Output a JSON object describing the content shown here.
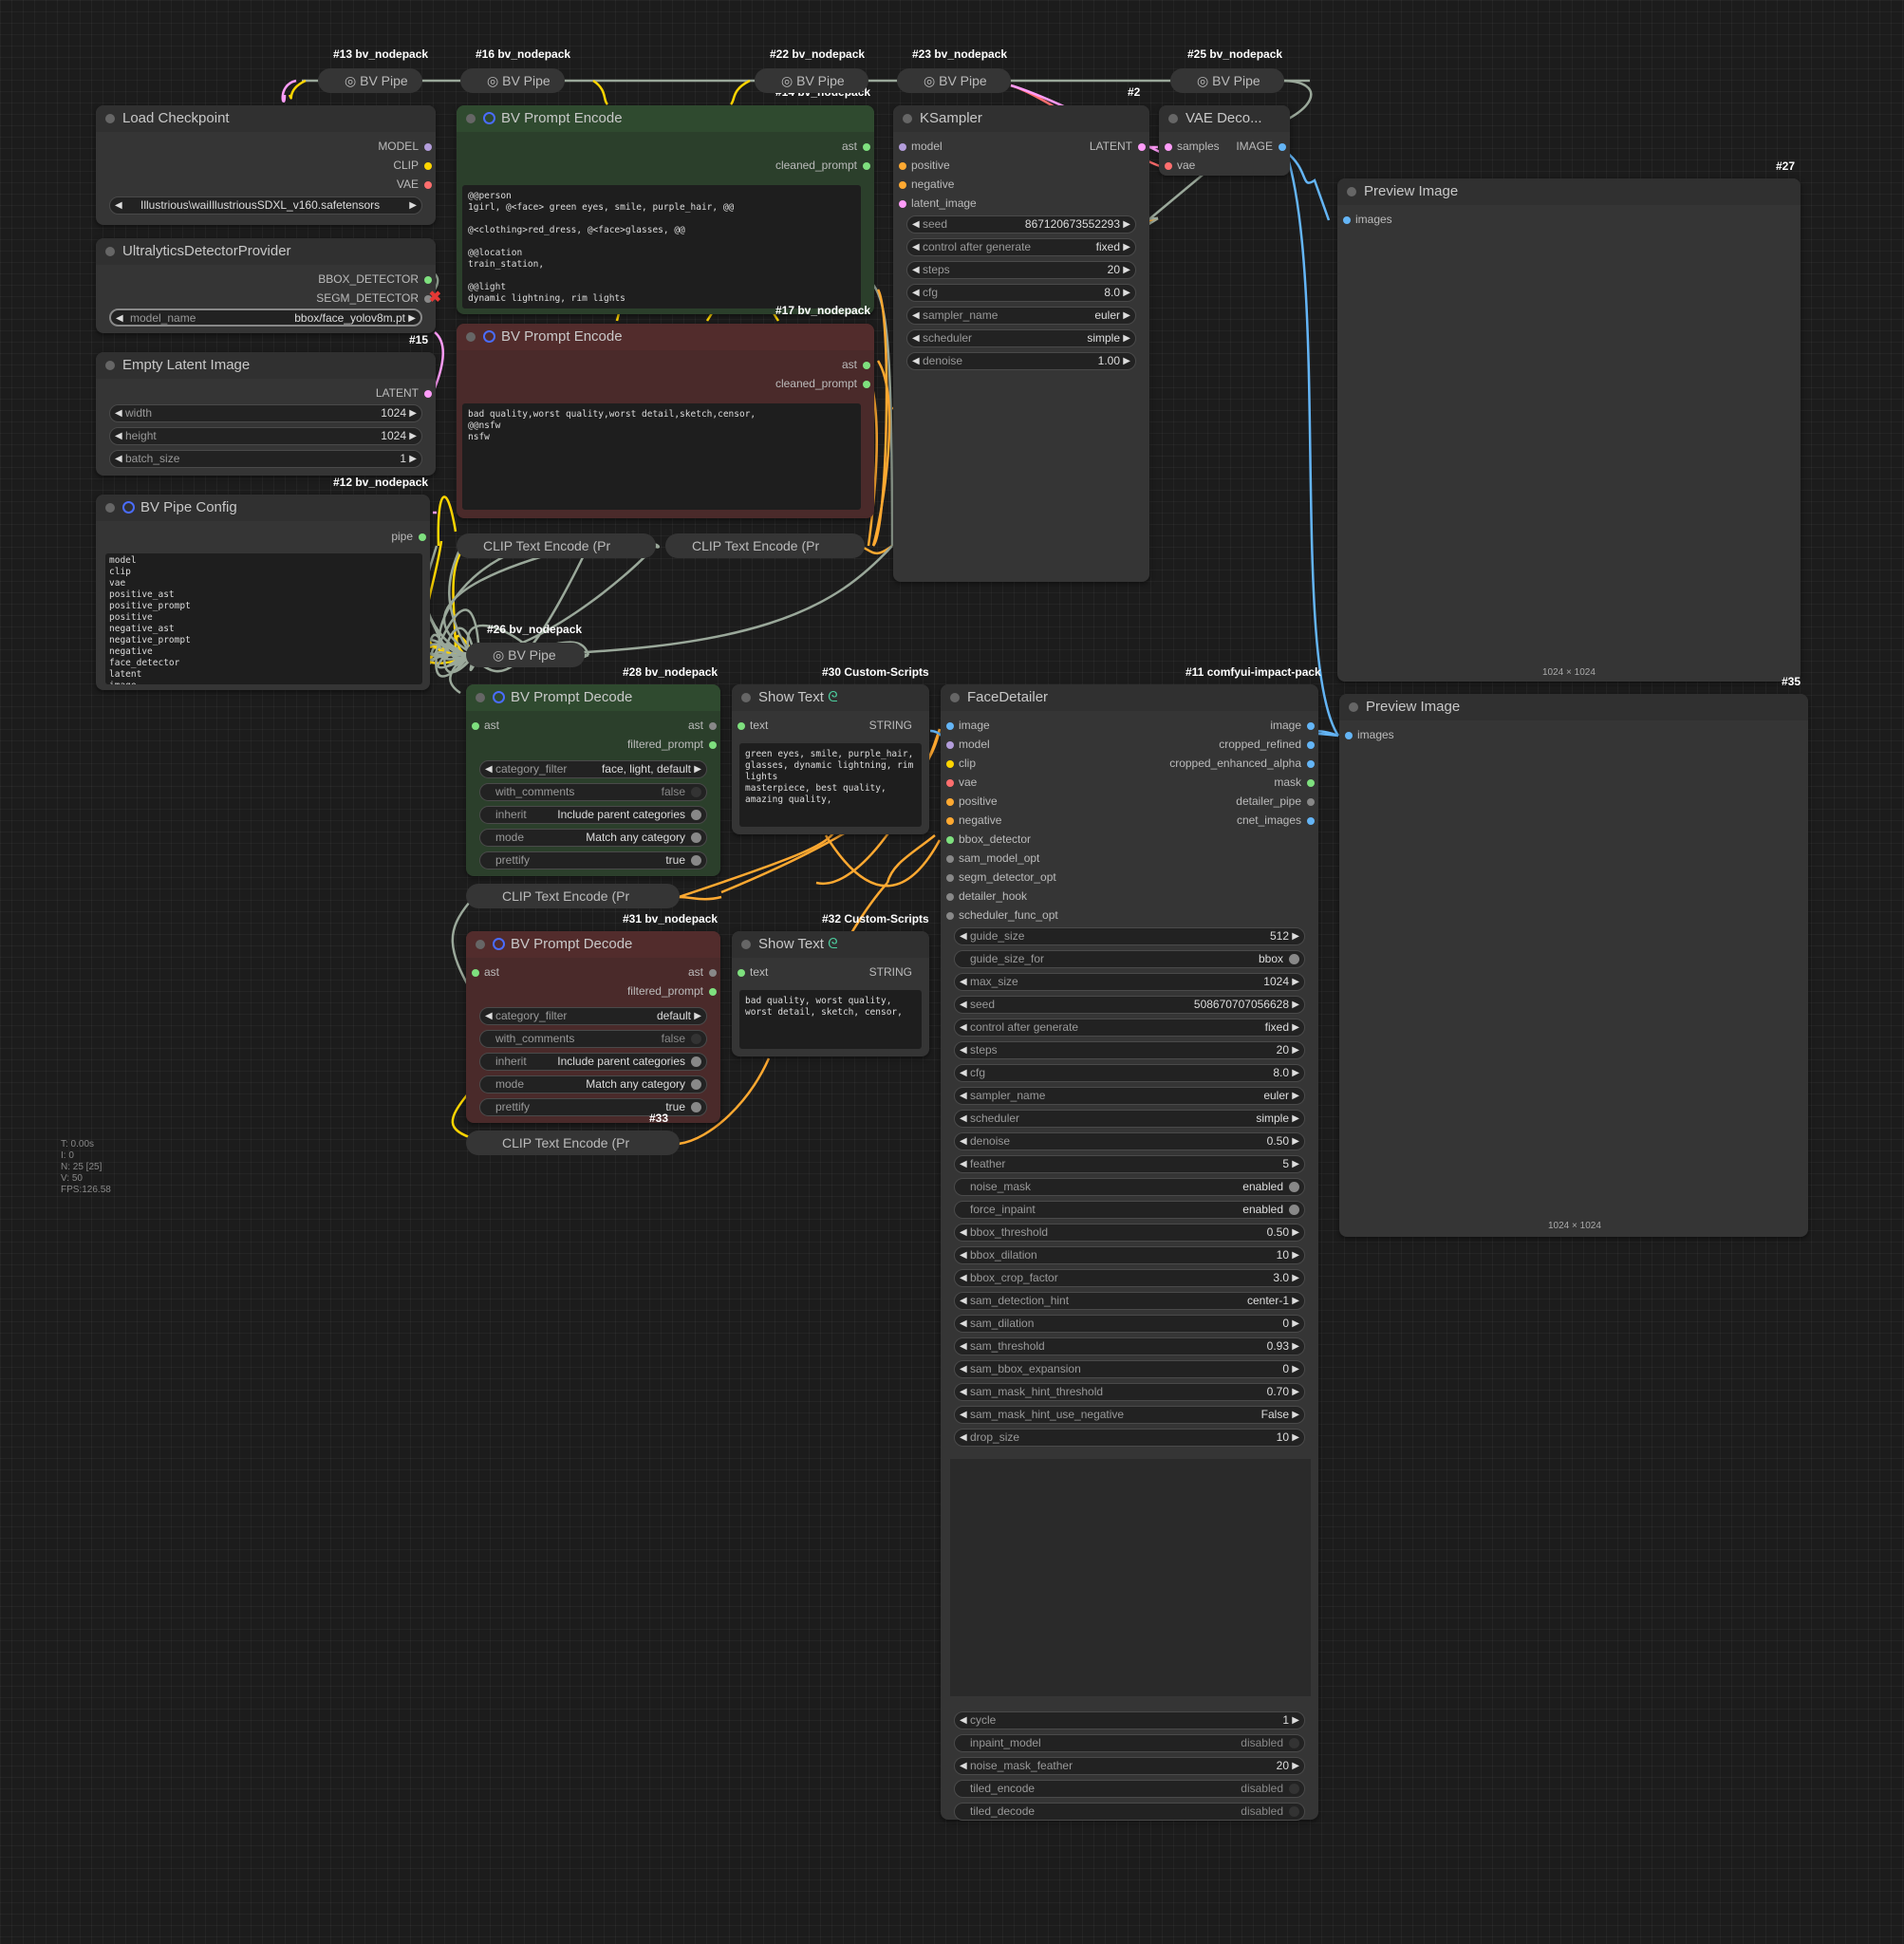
{
  "tags": {
    "t13": "#13 bv_nodepack",
    "t16": "#16 bv_nodepack",
    "t22": "#22 bv_nodepack",
    "t23": "#23 bv_nodepack",
    "t25": "#25 bv_nodepack",
    "t14": "#14 bv_nodepack",
    "t2": "#2",
    "t27": "#27",
    "t15": "#15",
    "t17": "#17 bv_nodepack",
    "t12": "#12 bv_nodepack",
    "t26": "#26 bv_nodepack",
    "t28": "#28 bv_nodepack",
    "t30": "#30 Custom-Scripts",
    "t11": "#11 comfyui-impact-pack",
    "t35": "#35",
    "t31": "#31 bv_nodepack",
    "t32": "#32 Custom-Scripts",
    "t33": "#33"
  },
  "pipes": {
    "label": "BV Pipe"
  },
  "load_checkpoint": {
    "title": "Load Checkpoint",
    "outputs": [
      "MODEL",
      "CLIP",
      "VAE"
    ],
    "ckpt_name": "Illustrious\\waiIllustriousSDXL_v160.safetensors"
  },
  "detector": {
    "title": "UltralyticsDetectorProvider",
    "outputs": [
      "BBOX_DETECTOR",
      "SEGM_DETECTOR"
    ],
    "model_label": "model_name",
    "model_value": "bbox/face_yolov8m.pt"
  },
  "latent": {
    "title": "Empty Latent Image",
    "output": "LATENT",
    "width_label": "width",
    "width": "1024",
    "height_label": "height",
    "height": "1024",
    "batch_label": "batch_size",
    "batch": "1"
  },
  "pipe_config": {
    "title": "BV Pipe Config",
    "output": "pipe",
    "list": "model\nclip\nvae\npositive_ast\npositive_prompt\npositive\nnegative_ast\nnegative_prompt\nnegative\nface_detector\nlatent\nimage"
  },
  "prompt_pos": {
    "title": "BV Prompt Encode",
    "out1": "ast",
    "out2": "cleaned_prompt",
    "text": "@@person\n1girl, @<face> green eyes, smile, purple_hair, @@\n\n@<clothing>red_dress, @<face>glasses, @@\n\n@@location\ntrain_station,\n\n@@light\ndynamic lightning, rim lights\n\n@@"
  },
  "prompt_neg": {
    "title": "BV Prompt Encode",
    "out1": "ast",
    "out2": "cleaned_prompt",
    "text": "bad quality,worst quality,worst detail,sketch,censor,\n@@nsfw\nnsfw"
  },
  "clip_text": "CLIP Text Encode (Pr",
  "ksampler": {
    "title": "KSampler",
    "inputs": [
      "model",
      "positive",
      "negative",
      "latent_image"
    ],
    "output": "LATENT",
    "widgets": [
      {
        "l": "seed",
        "v": "867120673552293"
      },
      {
        "l": "control after generate",
        "v": "fixed"
      },
      {
        "l": "steps",
        "v": "20"
      },
      {
        "l": "cfg",
        "v": "8.0"
      },
      {
        "l": "sampler_name",
        "v": "euler"
      },
      {
        "l": "scheduler",
        "v": "simple"
      },
      {
        "l": "denoise",
        "v": "1.00"
      }
    ]
  },
  "vae_decode": {
    "title": "VAE Deco...",
    "in1": "samples",
    "in2": "vae",
    "out": "IMAGE"
  },
  "preview1": {
    "title": "Preview Image",
    "input": "images",
    "caption": "1024 × 1024"
  },
  "preview2": {
    "title": "Preview Image",
    "input": "images",
    "caption": "1024 × 1024"
  },
  "decode_pos": {
    "title": "BV Prompt Decode",
    "in": "ast",
    "out1": "ast",
    "out2": "filtered_prompt",
    "widgets": [
      {
        "l": "category_filter",
        "v": "face, light, default"
      },
      {
        "l": "with_comments",
        "v": "false"
      },
      {
        "l": "inherit",
        "v": "Include parent categories"
      },
      {
        "l": "mode",
        "v": "Match any category"
      },
      {
        "l": "prettify",
        "v": "true"
      }
    ]
  },
  "decode_neg": {
    "title": "BV Prompt Decode",
    "in": "ast",
    "out1": "ast",
    "out2": "filtered_prompt",
    "widgets": [
      {
        "l": "category_filter",
        "v": "default"
      },
      {
        "l": "with_comments",
        "v": "false"
      },
      {
        "l": "inherit",
        "v": "Include parent categories"
      },
      {
        "l": "mode",
        "v": "Match any category"
      },
      {
        "l": "prettify",
        "v": "true"
      }
    ]
  },
  "show1": {
    "title": "Show Text",
    "in": "text",
    "out": "STRING",
    "text": "green eyes, smile, purple_hair, glasses, dynamic lightning, rim lights\nmasterpiece, best quality, amazing quality,"
  },
  "show2": {
    "title": "Show Text",
    "in": "text",
    "out": "STRING",
    "text": "bad quality, worst quality, worst detail, sketch, censor,"
  },
  "face": {
    "title": "FaceDetailer",
    "inputs": [
      "image",
      "model",
      "clip",
      "vae",
      "positive",
      "negative",
      "bbox_detector",
      "sam_model_opt",
      "segm_detector_opt",
      "detailer_hook",
      "scheduler_func_opt"
    ],
    "outputs": [
      "image",
      "cropped_refined",
      "cropped_enhanced_alpha",
      "mask",
      "detailer_pipe",
      "cnet_images"
    ],
    "widgets": [
      {
        "l": "guide_size",
        "v": "512"
      },
      {
        "l": "guide_size_for",
        "v": "bbox"
      },
      {
        "l": "max_size",
        "v": "1024"
      },
      {
        "l": "seed",
        "v": "508670707056628"
      },
      {
        "l": "control after generate",
        "v": "fixed"
      },
      {
        "l": "steps",
        "v": "20"
      },
      {
        "l": "cfg",
        "v": "8.0"
      },
      {
        "l": "sampler_name",
        "v": "euler"
      },
      {
        "l": "scheduler",
        "v": "simple"
      },
      {
        "l": "denoise",
        "v": "0.50"
      },
      {
        "l": "feather",
        "v": "5"
      },
      {
        "l": "noise_mask",
        "v": "enabled"
      },
      {
        "l": "force_inpaint",
        "v": "enabled"
      },
      {
        "l": "bbox_threshold",
        "v": "0.50"
      },
      {
        "l": "bbox_dilation",
        "v": "10"
      },
      {
        "l": "bbox_crop_factor",
        "v": "3.0"
      },
      {
        "l": "sam_detection_hint",
        "v": "center-1"
      },
      {
        "l": "sam_dilation",
        "v": "0"
      },
      {
        "l": "sam_threshold",
        "v": "0.93"
      },
      {
        "l": "sam_bbox_expansion",
        "v": "0"
      },
      {
        "l": "sam_mask_hint_threshold",
        "v": "0.70"
      },
      {
        "l": "sam_mask_hint_use_negative",
        "v": "False"
      },
      {
        "l": "drop_size",
        "v": "10"
      }
    ],
    "widgets2": [
      {
        "l": "cycle",
        "v": "1"
      },
      {
        "l": "inpaint_model",
        "v": "disabled"
      },
      {
        "l": "noise_mask_feather",
        "v": "20"
      },
      {
        "l": "tiled_encode",
        "v": "disabled"
      },
      {
        "l": "tiled_decode",
        "v": "disabled"
      }
    ]
  },
  "stats": {
    "t": "T: 0.00s",
    "i": "I: 0",
    "n": "N: 25 [25]",
    "v": "V: 50",
    "fps": "FPS:126.58"
  },
  "colors": {
    "model": "#b39ddb",
    "clip": "#ffd500",
    "vae": "#ff6e6e",
    "latent": "#ff9cf9",
    "image": "#64b5f6",
    "cond": "#ffa931",
    "pipe": "#a0b0a0",
    "detector": "#7ee07e"
  }
}
